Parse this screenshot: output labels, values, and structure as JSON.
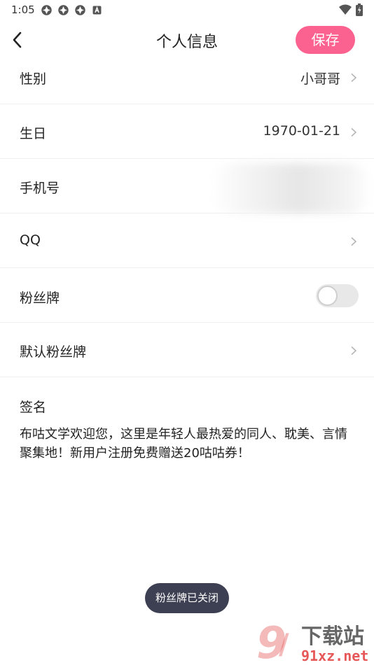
{
  "status_bar": {
    "time": "1:05",
    "icons": [
      "app-notification-icon",
      "app-notification-icon",
      "app-notification-icon",
      "a-letter-icon"
    ],
    "right_icons": [
      "wifi-icon",
      "battery-icon"
    ]
  },
  "header": {
    "title": "个人信息",
    "save_label": "保存",
    "accent_color": "#fc628f"
  },
  "rows": {
    "gender": {
      "label": "性别",
      "value": "小哥哥"
    },
    "birthday": {
      "label": "生日",
      "value": "1970-01-21"
    },
    "phone": {
      "label": "手机号"
    },
    "qq": {
      "label": "QQ"
    },
    "fan_badge": {
      "label": "粉丝牌",
      "enabled": false
    },
    "default_fan_badge": {
      "label": "默认粉丝牌"
    }
  },
  "signature": {
    "label": "签名",
    "text": "布咕文学欢迎您，这里是年轻人最热爱的同人、耽美、言情聚集地！新用户注册免费赠送20咕咕券！"
  },
  "toast": {
    "text": "粉丝牌已关闭"
  },
  "watermark": {
    "brand": "下载站",
    "domain": "91xz.net"
  }
}
